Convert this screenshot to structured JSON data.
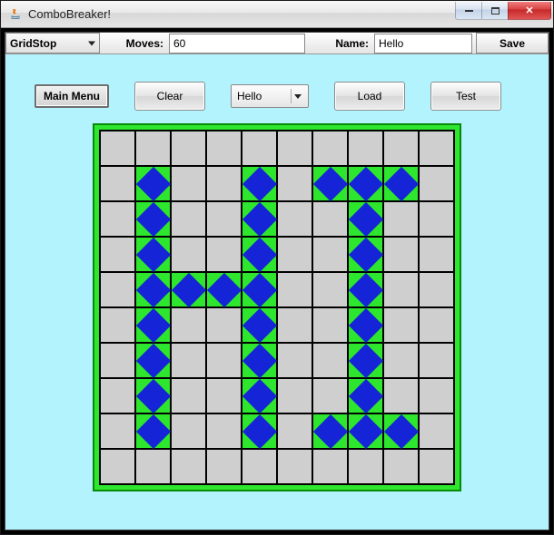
{
  "window": {
    "title": "ComboBreaker!"
  },
  "toolbar": {
    "mode_label": "GridStop",
    "moves_label": "Moves:",
    "moves_value": "60",
    "name_label": "Name:",
    "name_value": "Hello",
    "save_label": "Save"
  },
  "buttons": {
    "main_menu": "Main Menu",
    "clear": "Clear",
    "dropdown_value": "Hello",
    "load": "Load",
    "test": "Test"
  },
  "grid": {
    "cols": 10,
    "rows": 10,
    "filled": [
      [
        1,
        1
      ],
      [
        1,
        4
      ],
      [
        1,
        6
      ],
      [
        1,
        7
      ],
      [
        1,
        8
      ],
      [
        2,
        1
      ],
      [
        2,
        4
      ],
      [
        2,
        7
      ],
      [
        3,
        1
      ],
      [
        3,
        4
      ],
      [
        3,
        7
      ],
      [
        4,
        1
      ],
      [
        4,
        2
      ],
      [
        4,
        3
      ],
      [
        4,
        4
      ],
      [
        4,
        7
      ],
      [
        5,
        1
      ],
      [
        5,
        4
      ],
      [
        5,
        7
      ],
      [
        6,
        1
      ],
      [
        6,
        4
      ],
      [
        6,
        7
      ],
      [
        7,
        1
      ],
      [
        7,
        4
      ],
      [
        7,
        7
      ],
      [
        8,
        1
      ],
      [
        8,
        4
      ],
      [
        8,
        6
      ],
      [
        8,
        7
      ],
      [
        8,
        8
      ]
    ]
  },
  "colors": {
    "app_bg": "#b3f3fd",
    "grid_border": "#2ee62e",
    "cell_empty": "#cfcfcf",
    "cell_fill_bg": "#2ee62e",
    "diamond": "#1424d6"
  }
}
